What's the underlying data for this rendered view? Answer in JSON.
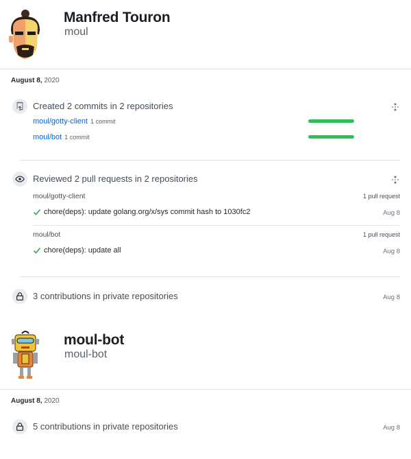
{
  "users": [
    {
      "name": "Manfred Touron",
      "login": "moul",
      "date": {
        "day": "August 8,",
        "year": "2020"
      },
      "commits": {
        "summary": "Created 2 commits in 2 repositories",
        "repos": [
          {
            "name": "moul/gotty-client",
            "count": "1 commit",
            "fraction": 1.0
          },
          {
            "name": "moul/bot",
            "count": "1 commit",
            "fraction": 1.0
          }
        ]
      },
      "reviews": {
        "summary": "Reviewed 2 pull requests in 2 repositories",
        "repos": [
          {
            "name": "moul/gotty-client",
            "count": "1 pull request",
            "pr_title": "chore(deps): update golang.org/x/sys commit hash to 1030fc2",
            "pr_date": "Aug 8"
          },
          {
            "name": "moul/bot",
            "count": "1 pull request",
            "pr_title": "chore(deps): update all",
            "pr_date": "Aug 8"
          }
        ]
      },
      "private": {
        "summary": "3 contributions in private repositories",
        "date": "Aug 8"
      }
    },
    {
      "name": "moul-bot",
      "login": "moul-bot",
      "date": {
        "day": "August 8,",
        "year": "2020"
      },
      "private": {
        "summary": "5 contributions in private repositories",
        "date": "Aug 8"
      }
    }
  ],
  "colors": {
    "bar": "#2ebf55",
    "link": "#0366d6",
    "check": "#28a745"
  },
  "icons": [
    "repo-push-icon",
    "eye-icon",
    "lock-icon",
    "fold-icon",
    "check-icon"
  ]
}
